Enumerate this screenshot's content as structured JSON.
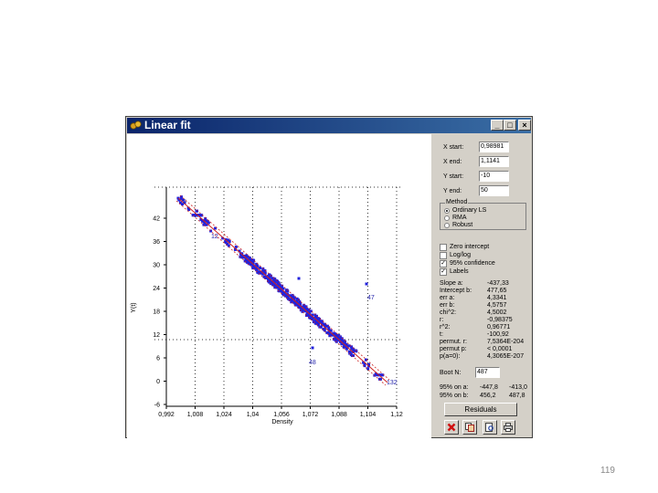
{
  "window": {
    "title": "Linear fit",
    "controls": {
      "minimize": "_",
      "maximize": "□",
      "close": "×"
    }
  },
  "plot": {
    "y_axis_label": "Y(t)",
    "x_axis_label": "Density",
    "x_ticks": [
      "0,992",
      "1,008",
      "1,024",
      "1,04",
      "1,056",
      "1,072",
      "1,088",
      "1,104",
      "1,12"
    ],
    "y_ticks": [
      "42",
      "36",
      "30",
      "24",
      "18",
      "12",
      "6",
      "0",
      "-6"
    ],
    "point_labels": [
      "5",
      "12",
      "47",
      "48",
      "132"
    ],
    "colors": {
      "points": "#2222dd",
      "fit_line": "#cc2222",
      "labels": "#2222aa"
    }
  },
  "panel": {
    "fields": [
      {
        "label": "X start:",
        "value": "0,98981"
      },
      {
        "label": "X end:",
        "value": "1,1141"
      },
      {
        "label": "Y start:",
        "value": "-10"
      },
      {
        "label": "Y end:",
        "value": "50"
      }
    ],
    "method": {
      "title": "Method",
      "options": [
        {
          "label": "Ordinary LS",
          "selected": true
        },
        {
          "label": "RMA",
          "selected": false
        },
        {
          "label": "Robust",
          "selected": false
        }
      ]
    },
    "checkboxes": [
      {
        "label": "Zero intercept",
        "checked": false
      },
      {
        "label": "Log/log",
        "checked": false
      },
      {
        "label": "95% confidence",
        "checked": true
      },
      {
        "label": "Labels",
        "checked": true
      }
    ],
    "results": [
      {
        "key": "Slope a:",
        "value": "-437,33"
      },
      {
        "key": "Intercept b:",
        "value": "477,65"
      },
      {
        "key": "err a:",
        "value": "4,3341"
      },
      {
        "key": "err b:",
        "value": "4,5757"
      },
      {
        "key": "chi^2:",
        "value": "4,5002"
      },
      {
        "key": "r:",
        "value": "-0,98375"
      },
      {
        "key": "r^2:",
        "value": "0,96771"
      },
      {
        "key": "t:",
        "value": "-100,92"
      },
      {
        "key": "permut. r:",
        "value": "7,5364E-204"
      },
      {
        "key": "permut p:",
        "value": "< 0,0001"
      },
      {
        "key": "p(a=0):",
        "value": "4,3065E-207"
      }
    ],
    "boot_label": "Boot N:",
    "boot_value": "487",
    "ci_a": {
      "key": "95% on a:",
      "lo": "-447,8",
      "hi": "-413,0"
    },
    "ci_b": {
      "key": "95% on b:",
      "lo": "456,2",
      "hi": "487,8"
    },
    "residuals_button": "Residuals"
  },
  "page_number": "119"
}
